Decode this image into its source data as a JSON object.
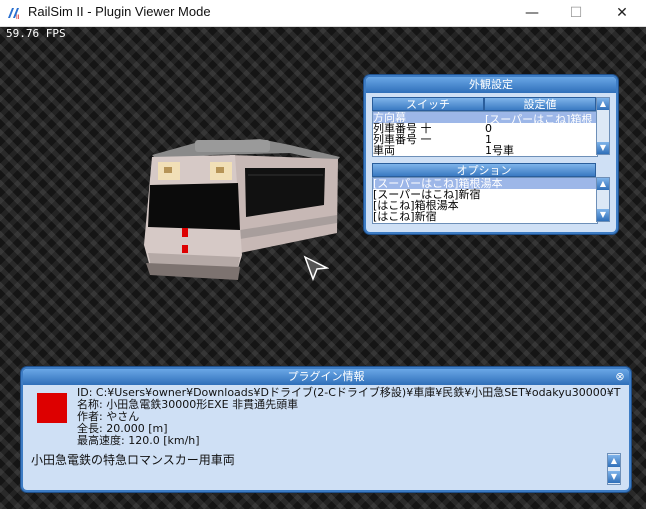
{
  "window": {
    "title": "RailSim II - Plugin Viewer Mode",
    "minimize": "—",
    "maximize": "☐",
    "close": "✕"
  },
  "viewport": {
    "fps": "59.76 FPS"
  },
  "appearance_panel": {
    "title": "外観設定",
    "col_switch": "スイッチ",
    "col_value": "設定値",
    "rows": [
      {
        "switch": "方向幕",
        "value": "[スーパーはこね]箱根",
        "selected": true
      },
      {
        "switch": "列車番号 十",
        "value": "0",
        "selected": false
      },
      {
        "switch": "列車番号 一",
        "value": "1",
        "selected": false
      },
      {
        "switch": "車両",
        "value": "1号車",
        "selected": false
      }
    ],
    "options_title": "オプション",
    "options": [
      {
        "label": "[スーパーはこね]箱根湯本",
        "selected": true
      },
      {
        "label": "[スーパーはこね]新宿",
        "selected": false
      },
      {
        "label": "[はこね]箱根湯本",
        "selected": false
      },
      {
        "label": "[はこね]新宿",
        "selected": false
      }
    ]
  },
  "plugin_panel": {
    "title": "プラグイン情報",
    "close_icon": "⊗",
    "swatch_color": "#dd0000",
    "id_line": "ID: C:¥Users¥owner¥Downloads¥Dドライブ(2-Cドライブ移設)¥車庫¥民鉄¥小田急SET¥odakyu30000¥T",
    "name_line": "名称: 小田急電鉄30000形EXE 非貫通先頭車",
    "author_line": "作者: やさん",
    "length_line": "全長: 20.000 [m]",
    "speed_line": "最高速度: 120.0 [km/h]",
    "description": "小田急電鉄の特急ロマンスカー用車両"
  }
}
